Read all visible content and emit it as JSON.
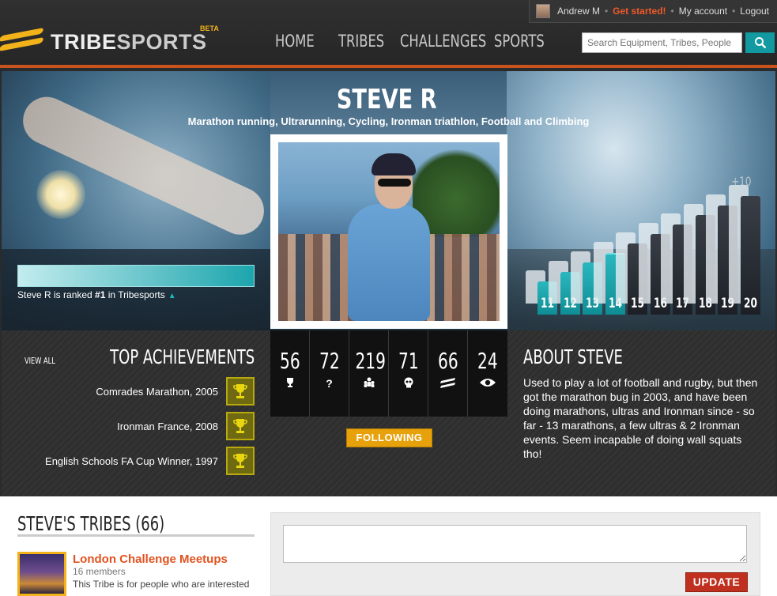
{
  "userbar": {
    "username": "Andrew M",
    "get_started": "Get started!",
    "my_account": "My account",
    "logout": "Logout",
    "sep": "•"
  },
  "header": {
    "logo_tribe": "TRIBE",
    "logo_sports": "SPORTS",
    "logo_beta": "BETA",
    "nav": [
      "HOME",
      "TRIBES",
      "CHALLENGES",
      "SPORTS"
    ],
    "search_placeholder": "Search Equipment, Tribes, People"
  },
  "profile": {
    "name": "STEVE R",
    "sports": "Marathon running, Ultrarunning, Cycling, Ironman triathlon, Football and Climbing",
    "rank_text_prefix": "Steve R is ranked ",
    "rank_value": "#1",
    "rank_text_suffix": " in Tribesports",
    "rank_progress": 1.0,
    "current_level": 14,
    "levels": [
      11,
      12,
      13,
      14,
      15,
      16,
      17,
      18,
      19,
      20
    ],
    "levels_plus": "+10"
  },
  "achievements": {
    "view_all": "VIEW ALL",
    "title": "TOP ACHIEVEMENTS",
    "items": [
      "Comrades Marathon, 2005",
      "Ironman France, 2008",
      "English Schools FA Cup Winner, 1997"
    ]
  },
  "stats": [
    {
      "value": "56",
      "icon": "trophy-icon"
    },
    {
      "value": "72",
      "icon": "question-icon"
    },
    {
      "value": "219",
      "icon": "people-icon"
    },
    {
      "value": "71",
      "icon": "skull-icon"
    },
    {
      "value": "66",
      "icon": "tribe-icon"
    },
    {
      "value": "24",
      "icon": "eye-icon"
    }
  ],
  "follow_label": "FOLLOWING",
  "about": {
    "title": "ABOUT STEVE",
    "text": "Used to play a lot of football and rugby, but then got the marathon bug in 2003, and have been doing marathons, ultras and Ironman since - so far - 13 marathons, a few ultras & 2 Ironman events. Seem incapable of doing wall squats tho!"
  },
  "tribes": {
    "title": "STEVE'S TRIBES (66)",
    "items": [
      {
        "name": "London Challenge Meetups",
        "members": "16 members",
        "desc": "This Tribe is for people who are interested"
      }
    ]
  },
  "update_label": "UPDATE",
  "colors": {
    "accent_orange": "#c9531e",
    "teal": "#129aa0",
    "gold": "#f1b21a",
    "update_red": "#c0301f"
  }
}
